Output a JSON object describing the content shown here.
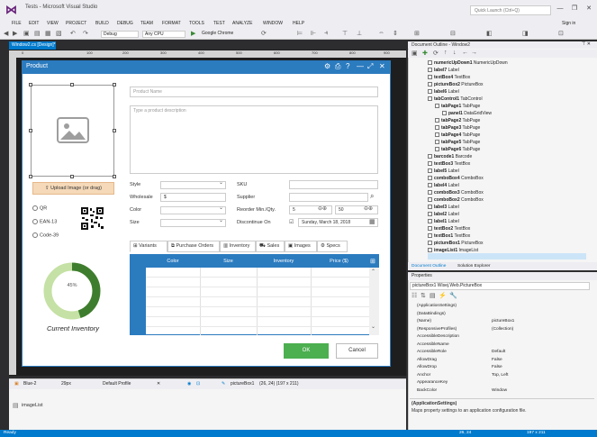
{
  "window": {
    "title": "Tests - Microsoft Visual Studio",
    "quick_launch_placeholder": "Quick Launch (Ctrl+Q)",
    "sign_in": "Sign in",
    "min": "—",
    "max": "❐",
    "close": "✕"
  },
  "menu": [
    "FILE",
    "EDIT",
    "VIEW",
    "PROJECT",
    "BUILD",
    "DEBUG",
    "TEAM",
    "FORMAT",
    "TOOLS",
    "TEST",
    "ANALYZE",
    "WINDOW",
    "HELP"
  ],
  "toolbar": {
    "config": "Debug",
    "platform": "Any CPU",
    "run_target": "Google Chrome"
  },
  "designer": {
    "doc_tab": "Window2.cs [Design]*",
    "ruler_ticks": [
      "0",
      "100",
      "200",
      "300",
      "400",
      "500",
      "600",
      "700",
      "800",
      "900",
      "1000"
    ]
  },
  "form": {
    "title": "Product",
    "product_name_placeholder": "Product Name",
    "description_placeholder": "Type a product description",
    "upload_label": "Upload Image (or drag)",
    "barcode_options": [
      "QR",
      "EAN-13",
      "Code-39"
    ],
    "inventory_percent": "45%",
    "inventory_value": 0.45,
    "inventory_label": "Current Inventory",
    "fields_left": [
      "Style",
      "Wholesale",
      "Color",
      "Size"
    ],
    "wholesale_value": "$",
    "fields_right": [
      "SKU",
      "Supplier",
      "Reorder Min./Qty.",
      "Discontinue On"
    ],
    "reorder_min": "5",
    "reorder_qty": "50",
    "discontinue_date": "Sunday, March 18, 2018",
    "tabs": [
      "Variants",
      "Purchase Orders",
      "Inventory",
      "Sales",
      "Images",
      "Specs"
    ],
    "grid_columns": [
      "Color",
      "Size",
      "Inventory",
      "Price ($)"
    ],
    "ok": "OK",
    "cancel": "Cancel"
  },
  "tray": {
    "theme": "Blue-2",
    "zoom": "29px",
    "profile": "Default Profile",
    "selected": "pictureBox1",
    "coords": "(26, 24) (197 x 211)",
    "component": "imageList"
  },
  "outline": {
    "title": "Document Outline - Window2",
    "items": [
      {
        "name": "numericUpDown1",
        "type": "NumericUpDown",
        "indent": 0
      },
      {
        "name": "label7",
        "type": "Label",
        "indent": 0
      },
      {
        "name": "textBox4",
        "type": "TextBox",
        "indent": 0
      },
      {
        "name": "pictureBox2",
        "type": "PictureBox",
        "indent": 0
      },
      {
        "name": "label6",
        "type": "Label",
        "indent": 0
      },
      {
        "name": "tabControl1",
        "type": "TabControl",
        "indent": 0
      },
      {
        "name": "tabPage1",
        "type": "TabPage",
        "indent": 1
      },
      {
        "name": "panel1",
        "type": "DataGridView",
        "indent": 2
      },
      {
        "name": "tabPage2",
        "type": "TabPage",
        "indent": 1
      },
      {
        "name": "tabPage3",
        "type": "TabPage",
        "indent": 1
      },
      {
        "name": "tabPage4",
        "type": "TabPage",
        "indent": 1
      },
      {
        "name": "tabPage5",
        "type": "TabPage",
        "indent": 1
      },
      {
        "name": "tabPage6",
        "type": "TabPage",
        "indent": 1
      },
      {
        "name": "barcode1",
        "type": "Barcode",
        "indent": 0
      },
      {
        "name": "textBox3",
        "type": "TextBox",
        "indent": 0
      },
      {
        "name": "label5",
        "type": "Label",
        "indent": 0
      },
      {
        "name": "comboBox4",
        "type": "ComboBox",
        "indent": 0
      },
      {
        "name": "label4",
        "type": "Label",
        "indent": 0
      },
      {
        "name": "comboBox3",
        "type": "ComboBox",
        "indent": 0
      },
      {
        "name": "comboBox2",
        "type": "ComboBox",
        "indent": 0
      },
      {
        "name": "label3",
        "type": "Label",
        "indent": 0
      },
      {
        "name": "label2",
        "type": "Label",
        "indent": 0
      },
      {
        "name": "label1",
        "type": "Label",
        "indent": 0
      },
      {
        "name": "textBox2",
        "type": "TextBox",
        "indent": 0
      },
      {
        "name": "textBox1",
        "type": "TextBox",
        "indent": 0
      },
      {
        "name": "pictureBox1",
        "type": "PictureBox",
        "indent": 0
      },
      {
        "name": "imageList1",
        "type": "ImageList",
        "indent": 0
      }
    ],
    "tabs": [
      "Document Outline",
      "Solution Explorer"
    ]
  },
  "properties": {
    "title": "Properties",
    "object": "pictureBox1  Wisej.Web.PictureBox",
    "rows": [
      {
        "name": "(ApplicationSettings)",
        "value": ""
      },
      {
        "name": "(DataBindings)",
        "value": ""
      },
      {
        "name": "(Name)",
        "value": "pictureBox1"
      },
      {
        "name": "(ResponsiveProfiles)",
        "value": "(Collection)"
      },
      {
        "name": "AccessibleDescription",
        "value": ""
      },
      {
        "name": "AccessibleName",
        "value": ""
      },
      {
        "name": "AccessibleRole",
        "value": "Default"
      },
      {
        "name": "AllowDrag",
        "value": "False"
      },
      {
        "name": "AllowDrop",
        "value": "False"
      },
      {
        "name": "Anchor",
        "value": "Top, Left"
      },
      {
        "name": "AppearanceKey",
        "value": ""
      },
      {
        "name": "BackColor",
        "value": "Window"
      }
    ],
    "desc_title": "(ApplicationSettings)",
    "desc_text": "Maps property settings to an application configuration file."
  },
  "status": {
    "left": "Ready",
    "pos": "26, 24",
    "size": "197 x 211"
  },
  "colors": {
    "accent": "#007acc",
    "form_blue": "#2b7bbf",
    "ok_green": "#4caf50",
    "donut_green": "#8bc34a",
    "donut_dark": "#3e7d2e"
  }
}
